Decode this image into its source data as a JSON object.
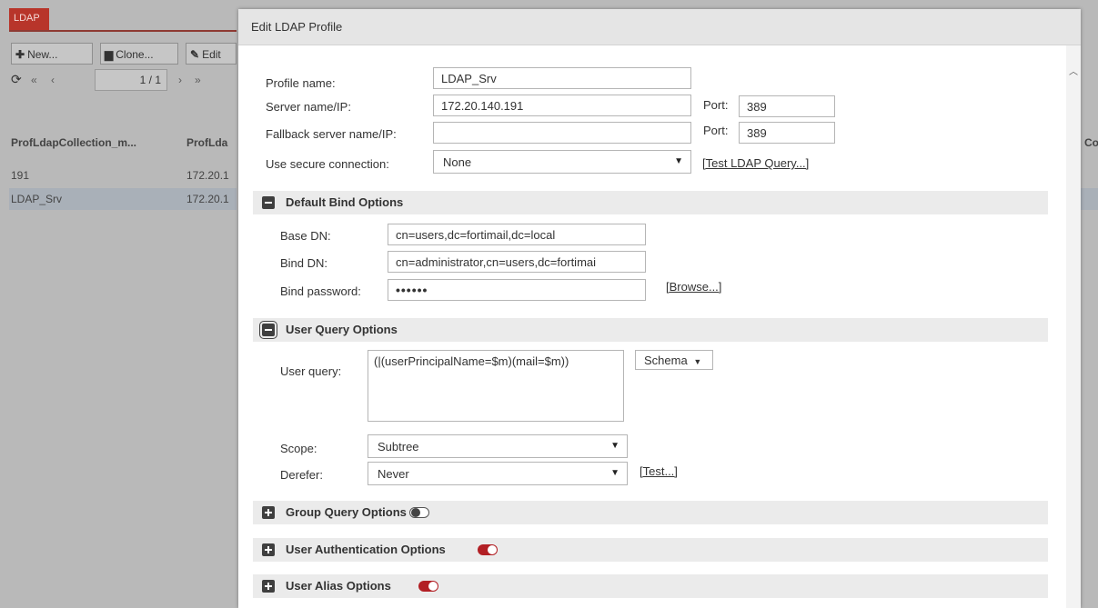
{
  "background": {
    "tab_label": "LDAP",
    "toolbar": {
      "new_label": "New...",
      "clone_label": "Clone...",
      "edit_label": "Edit"
    },
    "pager": {
      "page_value": "1 / 1"
    },
    "columns": {
      "col1": "ProfLdapCollection_m...",
      "col2": "ProfLda",
      "col_right": "Col"
    },
    "rows": [
      {
        "name": "191",
        "server": "172.20.1"
      },
      {
        "name": "LDAP_Srv",
        "server": "172.20.1"
      }
    ]
  },
  "modal": {
    "title": "Edit LDAP Profile",
    "profile_name_label": "Profile name:",
    "profile_name_value": "LDAP_Srv",
    "server_label": "Server name/IP:",
    "server_value": "172.20.140.191",
    "port_label": "Port:",
    "port_value": "389",
    "fallback_label": "Fallback server name/IP:",
    "fallback_value": "",
    "fallback_port_label": "Port:",
    "fallback_port_value": "389",
    "secure_label": "Use secure connection:",
    "secure_value": "None",
    "test_query_link": "[Test LDAP Query...]",
    "default_bind": {
      "title": "Default Bind Options",
      "base_dn_label": "Base DN:",
      "base_dn_value": "cn=users,dc=fortimail,dc=local",
      "bind_dn_label": "Bind DN:",
      "bind_dn_value": "cn=administrator,cn=users,dc=fortimai",
      "bind_password_label": "Bind password:",
      "bind_password_value": "••••••",
      "browse_link": "[Browse...]"
    },
    "user_query": {
      "title": "User Query Options",
      "query_label": "User query:",
      "query_value": "(|(userPrincipalName=$m)(mail=$m))",
      "schema_label": "Schema",
      "scope_label": "Scope:",
      "scope_value": "Subtree",
      "derefer_label": "Derefer:",
      "derefer_value": "Never",
      "test_link": "[Test...]"
    },
    "group_query": {
      "title": "Group Query Options",
      "enabled": false
    },
    "user_auth": {
      "title": "User Authentication Options",
      "enabled": true
    },
    "user_alias": {
      "title": "User Alias Options",
      "enabled": true
    },
    "colors": {
      "accent": "#b21f24",
      "tab": "#b8352a"
    }
  }
}
